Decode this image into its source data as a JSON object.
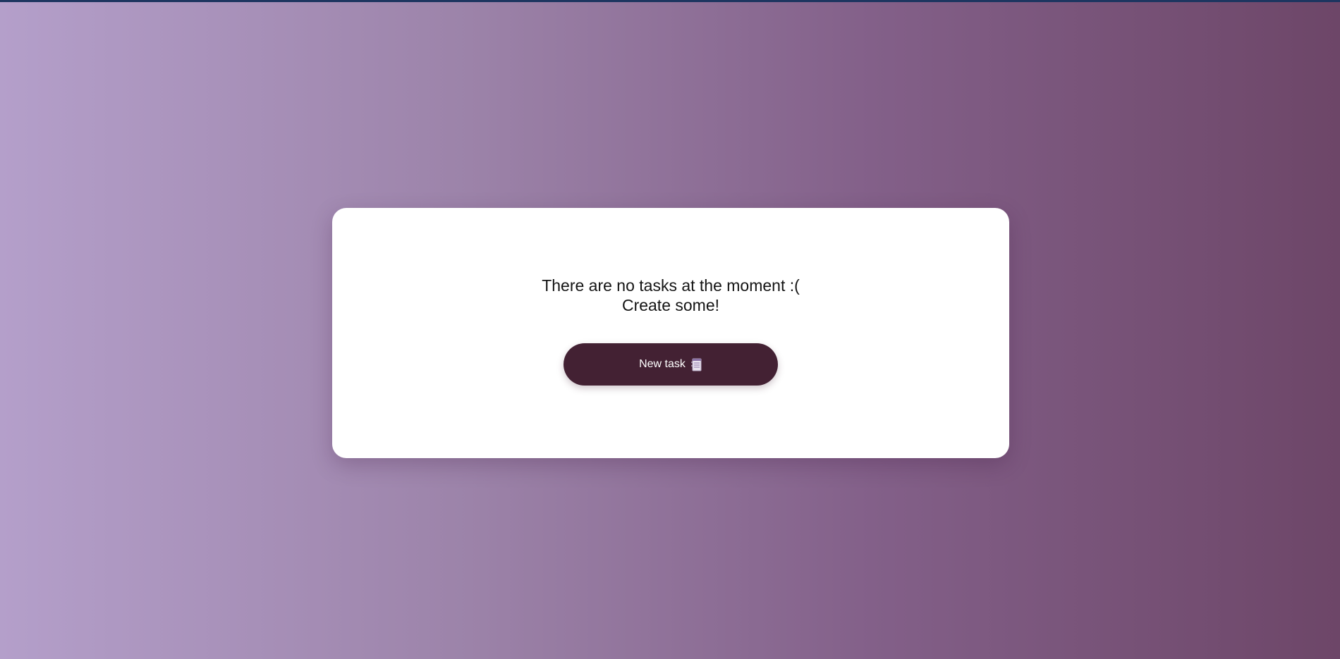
{
  "empty_state": {
    "line1": "There are no tasks at the moment :(",
    "line2": "Create some!"
  },
  "new_task_button": {
    "label": "New task",
    "icon": "notepad-icon"
  },
  "colors": {
    "gradient_start": "#b49fca",
    "gradient_end": "#6d4668",
    "button_bg": "#432133",
    "card_bg": "#ffffff",
    "top_bar": "#1d3560"
  }
}
